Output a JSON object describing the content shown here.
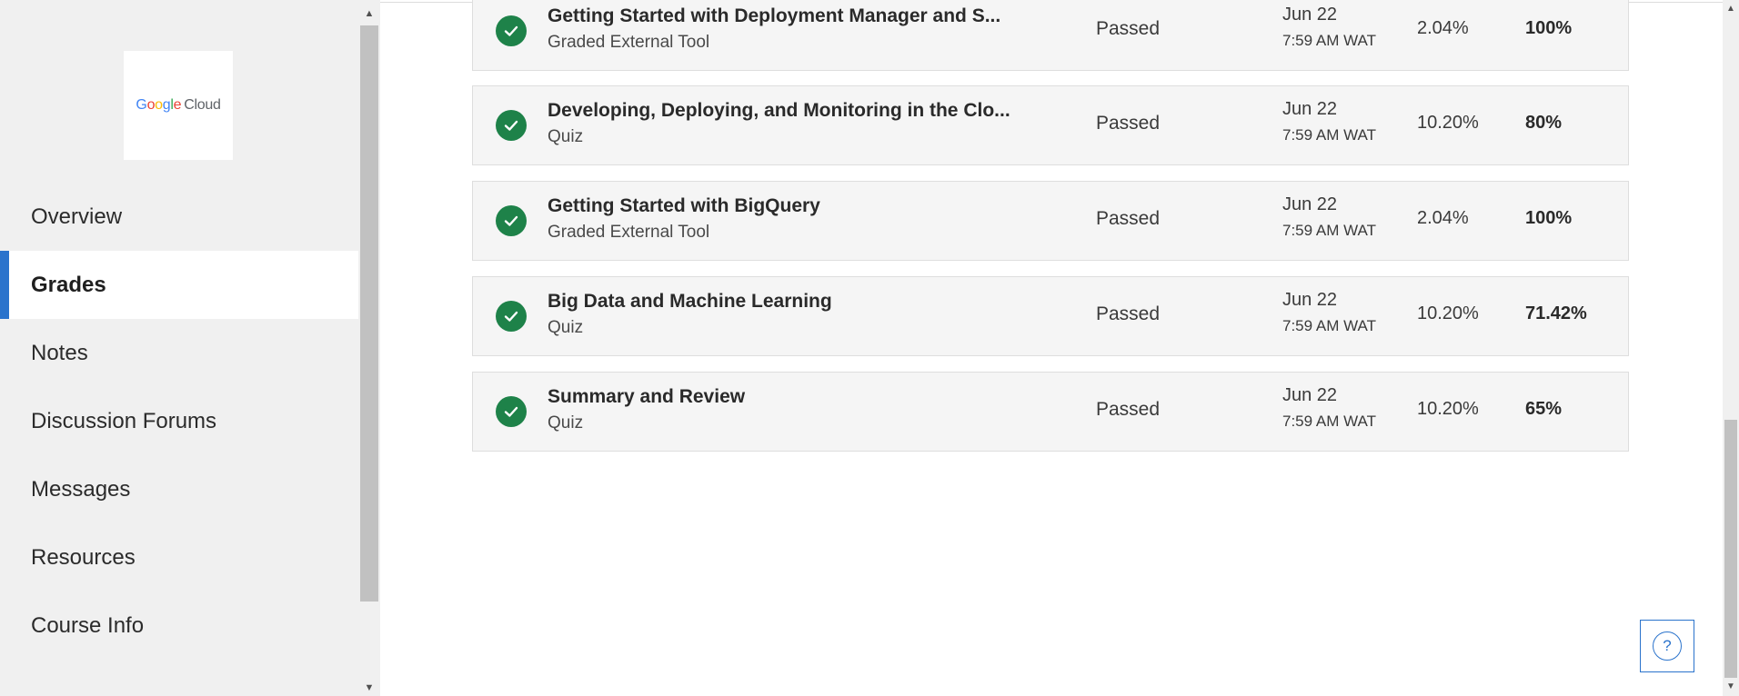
{
  "sidebar": {
    "logo": {
      "google": [
        "G",
        "o",
        "o",
        "g",
        "l",
        "e"
      ],
      "cloud": "Cloud",
      "colors": [
        "#4285f4",
        "#ea4335",
        "#fbbc05",
        "#4285f4",
        "#34a853",
        "#ea4335"
      ]
    },
    "items": [
      {
        "label": "Overview",
        "active": false
      },
      {
        "label": "Grades",
        "active": true
      },
      {
        "label": "Notes",
        "active": false
      },
      {
        "label": "Discussion Forums",
        "active": false
      },
      {
        "label": "Messages",
        "active": false
      },
      {
        "label": "Resources",
        "active": false
      },
      {
        "label": "Course Info",
        "active": false
      }
    ],
    "accent_color": "#2a73cc"
  },
  "grades": {
    "status_color": "#1e8249",
    "rows": [
      {
        "title": "Getting Started with Deployment Manager and S...",
        "type": "Graded External Tool",
        "status": "Passed",
        "date": "Jun 22",
        "time": "7:59 AM WAT",
        "weight": "2.04%",
        "grade": "100%"
      },
      {
        "title": "Developing, Deploying, and Monitoring in the Clo...",
        "type": "Quiz",
        "status": "Passed",
        "date": "Jun 22",
        "time": "7:59 AM WAT",
        "weight": "10.20%",
        "grade": "80%"
      },
      {
        "title": "Getting Started with BigQuery",
        "type": "Graded External Tool",
        "status": "Passed",
        "date": "Jun 22",
        "time": "7:59 AM WAT",
        "weight": "2.04%",
        "grade": "100%"
      },
      {
        "title": "Big Data and Machine Learning",
        "type": "Quiz",
        "status": "Passed",
        "date": "Jun 22",
        "time": "7:59 AM WAT",
        "weight": "10.20%",
        "grade": "71.42%"
      },
      {
        "title": "Summary and Review",
        "type": "Quiz",
        "status": "Passed",
        "date": "Jun 22",
        "time": "7:59 AM WAT",
        "weight": "10.20%",
        "grade": "65%"
      }
    ]
  },
  "help": {
    "icon": "question-mark-icon",
    "glyph": "?"
  }
}
